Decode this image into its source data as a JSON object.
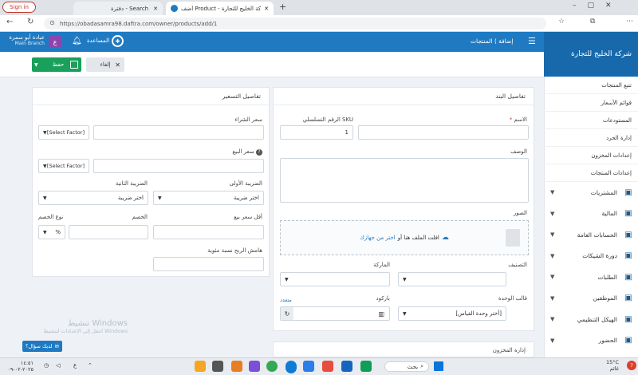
{
  "browser": {
    "signin": "Sign in",
    "tab1": "دفترة - Search",
    "tab2": "أضف Product - شركة الخليج للتجارة",
    "new_tab": "+",
    "url": "https://obadasamra98.daftra.com/owner/products/add/1"
  },
  "topbar": {
    "user_name": "عبادة أبو سمرة",
    "branch": "Main Branch",
    "avatar_letter": "ع",
    "help": "المساعدة",
    "breadcrumb_root": "المنتجات",
    "breadcrumb_sep": "⟩",
    "breadcrumb_current": "إضافة",
    "company": "شركة الخليج للتجارة"
  },
  "toolbar": {
    "save": "حفظ",
    "cancel": "إلغاء"
  },
  "sidebar": {
    "sub_items": [
      "تتبع المنتجات",
      "قوائم الأسعار",
      "المستودعات",
      "إدارة الجرد",
      "إعدادات المخزون",
      "إعدادات المنتجات"
    ],
    "main_items": [
      {
        "label": "المشتريات",
        "icon": "truck-icon"
      },
      {
        "label": "المالية",
        "icon": "money-icon"
      },
      {
        "label": "الحسابات العامة",
        "icon": "ledger-icon"
      },
      {
        "label": "دورة الشيكات",
        "icon": "cheque-icon"
      },
      {
        "label": "الطلبات",
        "icon": "orders-icon"
      },
      {
        "label": "الموظفين",
        "icon": "users-icon"
      },
      {
        "label": "الهيكل التنظيمي",
        "icon": "org-icon"
      },
      {
        "label": "الحضور",
        "icon": "calendar-icon"
      }
    ]
  },
  "item_details": {
    "title": "تفاصيل البند",
    "name_label": "الاسم",
    "required_mark": "*",
    "sku_label": "الرقم التسلسلي SKU",
    "sku_value": "1",
    "desc_label": "الوصف",
    "images_label": "الصور",
    "upload_text": "افلت الملف هنا أو",
    "upload_link": "اختر من جهازك",
    "category_label": "التصنيف",
    "brand_label": "الماركة",
    "unit_label": "قالب الوحدة",
    "unit_value": "[أختر وحدة القياس]",
    "barcode_label": "باركود",
    "advanced_link": "متعدد"
  },
  "pricing": {
    "title": "تفاصيل التسعير",
    "purchase_label": "سعر الشراء",
    "factor_select": "[Select Factor]",
    "sell_label": "سعر البيع",
    "help_mark": "?",
    "tax1_label": "الضريبة الأولى",
    "tax2_label": "الضريبة الثانية",
    "tax_select": "اختر ضريبة",
    "min_price_label": "أقل سعر بيع",
    "discount_label": "الخصم",
    "discount_type_label": "نوع الخصم",
    "discount_type_value": "%",
    "margin_label": "هامش الربح نسبة مئوية"
  },
  "inventory": {
    "title": "إدارة المخزون"
  },
  "watermark": {
    "line1": "تنشيط Windows",
    "line2": "انتقل إلى الإعدادات لتنشيط Windows"
  },
  "chat_button": "لديك سؤال؟",
  "taskbar": {
    "time": "١٤:٥١",
    "date": "٢٠٢٥-٠٢-٠٩",
    "lang": "ع",
    "search": "بحث",
    "weather_temp": "15°C",
    "weather_desc": "غائم",
    "badge": "7"
  }
}
